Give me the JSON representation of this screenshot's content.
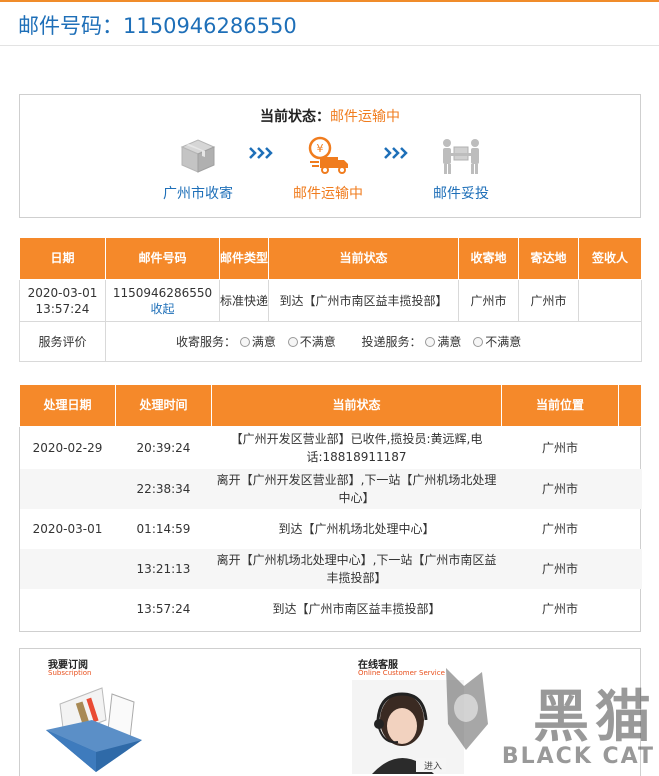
{
  "header": {
    "title": "邮件号码：1150946286550"
  },
  "status": {
    "label": "当前状态：",
    "value": "邮件运输中",
    "steps": [
      {
        "label": "广州市收寄",
        "icon": "package-box-icon",
        "active": false
      },
      {
        "label": "邮件运输中",
        "icon": "delivery-truck-icon",
        "active": true
      },
      {
        "label": "邮件妥投",
        "icon": "handover-icon",
        "active": false
      }
    ]
  },
  "summary_table": {
    "headers": [
      "日期",
      "邮件号码",
      "邮件类型",
      "当前状态",
      "收寄地",
      "寄达地",
      "签收人"
    ],
    "row": {
      "date": "2020-03-01 13:57:24",
      "mail_no": "1150946286550",
      "collapse_link": "收起",
      "type": "标准快递",
      "status": "到达【广州市南区益丰揽投部】",
      "origin": "广州市",
      "destination": "广州市",
      "signer": ""
    },
    "evaluation": {
      "label": "服务评价",
      "collect_label": "收寄服务：",
      "deliver_label": "投递服务：",
      "options": [
        "满意",
        "不满意"
      ]
    }
  },
  "track_table": {
    "headers": [
      "处理日期",
      "处理时间",
      "当前状态",
      "当前位置"
    ],
    "rows": [
      {
        "date": "2020-02-29",
        "time": "20:39:24",
        "status": "【广州开发区营业部】已收件,揽投员:黄远辉,电话:18818911187",
        "location": "广州市"
      },
      {
        "date": "",
        "time": "22:38:34",
        "status": "离开【广州开发区营业部】,下一站【广州机场北处理中心】",
        "location": "广州市"
      },
      {
        "date": "2020-03-01",
        "time": "01:14:59",
        "status": "到达【广州机场北处理中心】",
        "location": "广州市"
      },
      {
        "date": "",
        "time": "13:21:13",
        "status": "离开【广州机场北处理中心】,下一站【广州市南区益丰揽投部】",
        "location": "广州市"
      },
      {
        "date": "",
        "time": "13:57:24",
        "status": "到达【广州市南区益丰揽投部】",
        "location": "广州市"
      }
    ]
  },
  "promos": [
    {
      "title": "我要订阅",
      "subtitle": "Subscription"
    },
    {
      "title": "在线客服",
      "subtitle": "Online Customer Service",
      "enter": "进入"
    }
  ],
  "watermark": {
    "cn": "黑猫",
    "en": "BLACK CAT"
  },
  "colors": {
    "accent": "#f5892a",
    "link": "#1e6fb8",
    "active": "#f07c1e"
  }
}
